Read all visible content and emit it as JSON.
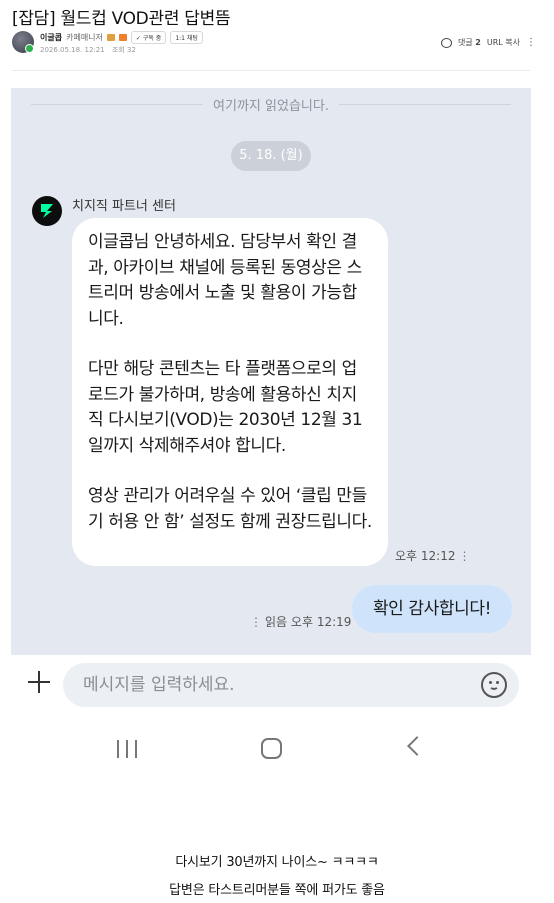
{
  "post": {
    "title": "[잡담] 월드컵 VOD관련 답변뜸",
    "author": {
      "name": "이글콥",
      "role": "카페매니저",
      "subscribe_label": "구독 중",
      "chat_label": "1:1 채팅"
    },
    "date": "2026.05.18. 12:21",
    "views": "조회 32",
    "comment_label": "댓글",
    "comment_count": "2",
    "copy_url_label": "URL 복사",
    "more_icon": "⋮"
  },
  "chat": {
    "read_marker": "여기까지 읽었습니다.",
    "date_divider": "5. 18. (월)",
    "sender_name": "치지직 파트너 센터",
    "incoming_message": {
      "paragraph_1": "이글콥님 안녕하세요. 담당부서 확인 결과, 아카이브 채널에 등록된 동영상은 스트리머 방송에서 노출 및 활용이 가능합니다.",
      "paragraph_2": "다만 해당 콘텐츠는 타 플랫폼으로의 업로드가 불가하며, 방송에 활용하신 치지직 다시보기(VOD)는 2030년 12월 31일까지 삭제해주셔야 합니다.",
      "paragraph_3": "영상 관리가 어려우실 수 있어 ‘클립 만들기 허용 안 함’ 설정도 함께 권장드립니다.",
      "time": "오후 12:12"
    },
    "outgoing_message": {
      "text": "확인 감사합니다!",
      "status": "읽음",
      "time": "오후 12:19"
    }
  },
  "input": {
    "placeholder": "메시지를 입력하세요."
  },
  "caption": {
    "line_1": "다시보기 30년까지 나이스~ ㅋㅋㅋㅋ",
    "line_2": "답변은 타스트리머분들 쪽에 퍼가도 좋음"
  },
  "colors": {
    "chat_background": "#e4e9f1",
    "incoming_bubble": "#ffffff",
    "outgoing_bubble": "#cfe4fb",
    "bot_avatar": "#0d0d0d",
    "bot_logo": "#00ffa3"
  }
}
